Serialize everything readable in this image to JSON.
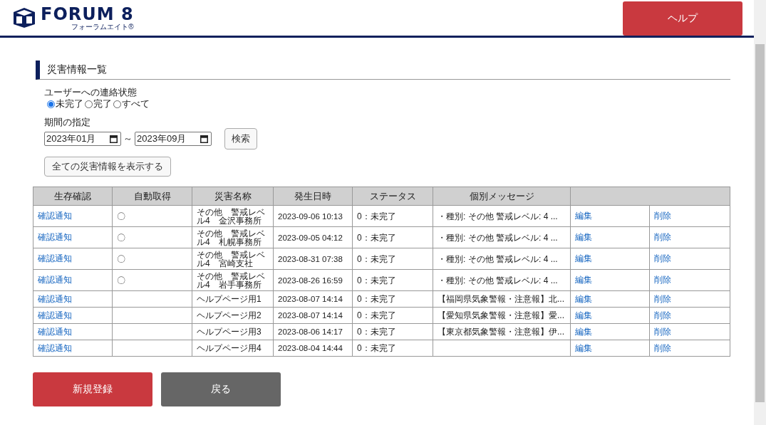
{
  "header": {
    "logo_text": "FORUM 8",
    "logo_subtext": "フォーラムエイト®",
    "help_button": "ヘルプ"
  },
  "section_title": "災害情報一覧",
  "contact_filter": {
    "label": "ユーザーへの連絡状態",
    "options": [
      {
        "label": "未完了",
        "selected": true
      },
      {
        "label": "完了",
        "selected": false
      },
      {
        "label": "すべて",
        "selected": false
      }
    ]
  },
  "period": {
    "label": "期間の指定",
    "from": "2023年01月",
    "separator": "～",
    "to": "2023年09月",
    "search_button": "検索"
  },
  "show_all_button": "全ての災害情報を表示する",
  "table": {
    "columns": [
      "生存確認",
      "自動取得",
      "災害名称",
      "発生日時",
      "ステータス",
      "個別メッセージ"
    ],
    "rows": [
      {
        "confirm": "確認通知",
        "auto": "〇",
        "name": "その他　警戒レベル4　金沢事務所",
        "date": "2023-09-06 10:13",
        "status": "0：未完了",
        "message": "・種別: その他 警戒レベル: 4 ...",
        "edit": "編集",
        "delete": "削除"
      },
      {
        "confirm": "確認通知",
        "auto": "〇",
        "name": "その他　警戒レベル4　札幌事務所",
        "date": "2023-09-05 04:12",
        "status": "0：未完了",
        "message": "・種別: その他 警戒レベル: 4 ...",
        "edit": "編集",
        "delete": "削除"
      },
      {
        "confirm": "確認通知",
        "auto": "〇",
        "name": "その他　警戒レベル4　宮崎支社",
        "date": "2023-08-31 07:38",
        "status": "0：未完了",
        "message": "・種別: その他 警戒レベル: 4 ...",
        "edit": "編集",
        "delete": "削除"
      },
      {
        "confirm": "確認通知",
        "auto": "〇",
        "name": "その他　警戒レベル4　岩手事務所",
        "date": "2023-08-26 16:59",
        "status": "0：未完了",
        "message": "・種別: その他 警戒レベル: 4 ...",
        "edit": "編集",
        "delete": "削除"
      },
      {
        "confirm": "確認通知",
        "name": "ヘルプページ用1",
        "date": "2023-08-07 14:14",
        "status": "0：未完了",
        "message": "【福岡県気象警報・注意報】北...",
        "edit": "編集",
        "delete": "削除"
      },
      {
        "confirm": "確認通知",
        "name": "ヘルプページ用2",
        "date": "2023-08-07 14:14",
        "status": "0：未完了",
        "message": "【愛知県気象警報・注意報】愛...",
        "edit": "編集",
        "delete": "削除"
      },
      {
        "confirm": "確認通知",
        "name": "ヘルプページ用3",
        "date": "2023-08-06 14:17",
        "status": "0：未完了",
        "message": "【東京都気象警報・注意報】伊...",
        "edit": "編集",
        "delete": "削除"
      },
      {
        "confirm": "確認通知",
        "name": "ヘルプページ用4",
        "date": "2023-08-04 14:44",
        "status": "0：未完了",
        "edit": "編集",
        "delete": "削除"
      }
    ]
  },
  "buttons": {
    "register": "新規登録",
    "back": "戻る"
  }
}
